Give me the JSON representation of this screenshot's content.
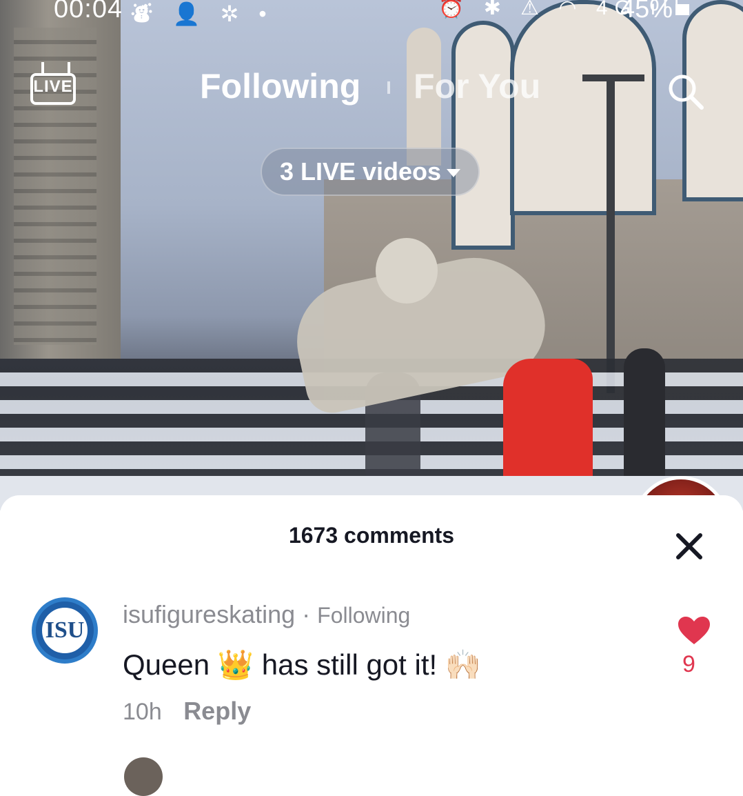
{
  "status_bar": {
    "time": "00:04",
    "left_icons": "⛇ 👤 ✲ •",
    "right_icons": "⏰ ✱ ⚠ ◠ 4G ıll",
    "battery": "45%"
  },
  "top_nav": {
    "live_label": "LIVE",
    "tab_following": "Following",
    "tab_for_you": "For You",
    "live_pill": "3 LIVE videos"
  },
  "comments": {
    "count_title": "1673 comments",
    "items": [
      {
        "avatar_text": "ISU",
        "username": "isufigureskating",
        "relation": "Following",
        "text": "Queen 👑 has still got it! 🙌🏻",
        "time": "10h",
        "reply_label": "Reply",
        "likes": "9"
      }
    ]
  },
  "colors": {
    "like": "#e0364f",
    "muted_text": "#8a8b91",
    "primary_text": "#161823",
    "isu_blue": "#1f5fa8"
  },
  "icons": [
    "live-tv-icon",
    "search-icon",
    "chevron-down-icon",
    "close-icon",
    "heart-icon"
  ]
}
